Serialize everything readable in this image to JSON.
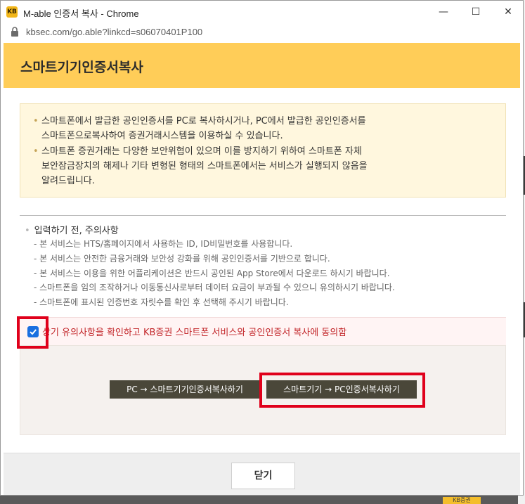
{
  "window": {
    "title": "M-able 인증서 복사 - Chrome",
    "app_icon_glyph": "KB",
    "minimize_glyph": "—",
    "maximize_glyph": "☐",
    "close_glyph": "✕",
    "url": "kbsec.com/go.able?linkcd=s06070401P100"
  },
  "header": {
    "title": "스마트기기인증서복사",
    "background": "#ffcd58"
  },
  "notice": {
    "items": [
      "스마트폰에서 발급한 공인인증서를 PC로 복사하시거나, PC에서 발급한 공인인증서를\n스마트폰으로복사하여 증권거래시스템을 이용하실 수 있습니다.",
      "스마트폰 증권거래는 다양한 보안위협이 있으며 이를 방지하기 위하여 스마트폰 자체\n보안잠금장치의 해제나 기타 변형된 형태의 스마트폰에서는 서비스가 실행되지 않음을\n알려드립니다."
    ]
  },
  "caution": {
    "title": "입력하기 전, 주의사항",
    "items": [
      "- 본 서비스는 HTS/홈페이지에서 사용하는 ID, ID비밀번호를 사용합니다.",
      "- 본 서비스는 안전한 금융거래와 보안성 강화를 위해 공인인증서를 기반으로 합니다.",
      "- 본 서비스는 이용을 위한 어플리케이션은 반드시 공인된 App Store에서 다운로드 하시기 바랍니다.",
      "- 스마트폰을 임의 조작하거나 이동통신사로부터 데이터 요금이 부과될 수 있으니 유의하시기 바랍니다.",
      "- 스마트폰에 표시된 인증번호 자릿수를 확인 후 선택해 주시기 바랍니다."
    ]
  },
  "agree": {
    "checked": true,
    "label": "상기 유의사항을 확인하고 KB증권 스마트폰 서비스와 공인인증서 복사에 동의함",
    "label_color": "#c3272b"
  },
  "actions": {
    "pc_to_smart": "PC → 스마트기기인증서복사하기",
    "smart_to_pc": "스마트기기 → PC인증서복사하기"
  },
  "footer": {
    "close_label": "닫기"
  },
  "background_page": {
    "logo_text": "KB증권"
  },
  "highlight_color": "#e0001b"
}
